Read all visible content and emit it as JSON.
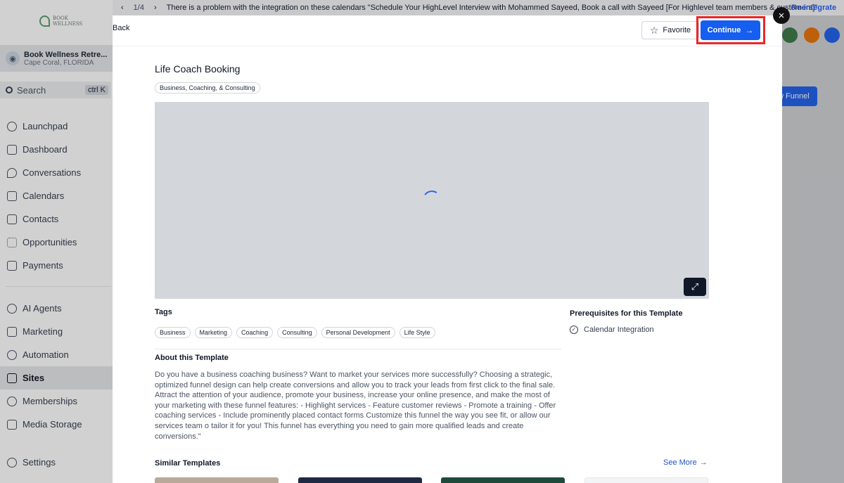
{
  "banner": {
    "pager": "1/4",
    "message": "There is a problem with the integration on these calendars \"Schedule Your HighLevel Interview with Mohammed Sayeed, Book a call with Sayeed [For Highlevel team members & customers]\"",
    "action": "Re-integrate"
  },
  "sidebar": {
    "logo_text": "BOOK WELLNESS",
    "location_name": "Book Wellness Retre...",
    "location_city": "Cape Coral, FLORIDA",
    "search_label": "Search",
    "search_shortcut": "ctrl K",
    "items_top": [
      {
        "label": "Launchpad",
        "icon": "rocket-icon"
      },
      {
        "label": "Dashboard",
        "icon": "grid-icon"
      },
      {
        "label": "Conversations",
        "icon": "chat-icon"
      },
      {
        "label": "Calendars",
        "icon": "calendar-icon"
      },
      {
        "label": "Contacts",
        "icon": "contacts-icon"
      },
      {
        "label": "Opportunities",
        "icon": "opportunities-icon"
      },
      {
        "label": "Payments",
        "icon": "payments-icon"
      }
    ],
    "items_bottom": [
      {
        "label": "AI Agents",
        "icon": "sparkle-icon"
      },
      {
        "label": "Marketing",
        "icon": "send-icon"
      },
      {
        "label": "Automation",
        "icon": "automation-icon"
      },
      {
        "label": "Sites",
        "icon": "sites-icon",
        "active": true
      },
      {
        "label": "Memberships",
        "icon": "membership-icon"
      },
      {
        "label": "Media Storage",
        "icon": "image-icon"
      }
    ],
    "settings_label": "Settings"
  },
  "background": {
    "new_funnel_label": "w Funnel"
  },
  "modal": {
    "back_label": "Back",
    "favorite_label": "Favorite",
    "continue_label": "Continue",
    "title": "Life Coach Booking",
    "category": "Business, Coaching, & Consulting",
    "tags_heading": "Tags",
    "tags": [
      "Business",
      "Marketing",
      "Coaching",
      "Consulting",
      "Personal Development",
      "Life Style"
    ],
    "about_heading": "About this Template",
    "about_text": "Do you have a business coaching business? Want to market your services more successfully? Choosing a strategic, optimized funnel design can help create conversions and allow you to track your leads from first click to the final sale. Attract the attention of your audience, promote your business, increase your online presence, and make the most of your marketing with these funnel features: - Highlight services - Feature customer reviews - Promote a training - Offer coaching services - Include prominently placed contact forms Customize this funnel the way you see fit, or allow our services team o tailor it for you! This funnel has everything you need to gain more qualified leads and create conversions.\"",
    "prereq_heading": "Prerequisites for this Template",
    "prereq_items": [
      "Calendar Integration"
    ],
    "similar_heading": "Similar Templates",
    "see_more_label": "See More"
  },
  "colors": {
    "primary": "#155eef",
    "highlight": "#ef2424",
    "link": "#2152c9"
  }
}
